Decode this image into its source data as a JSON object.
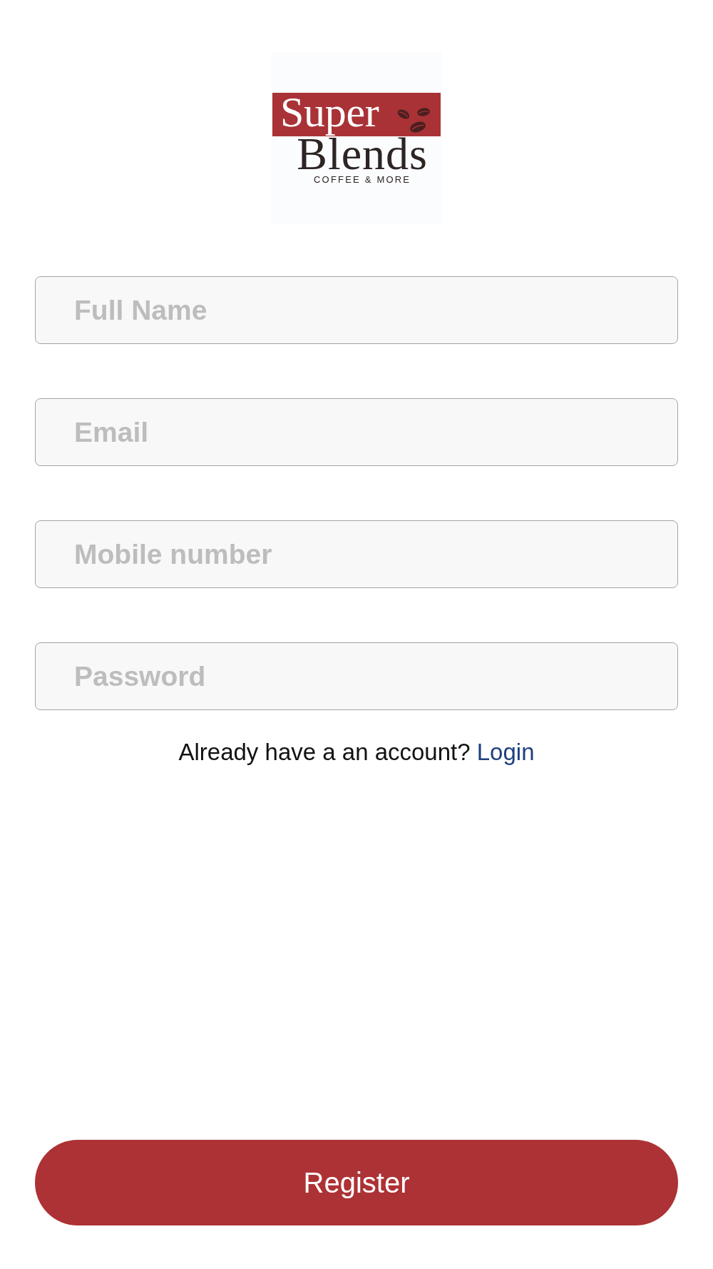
{
  "logo": {
    "title_top": "Super",
    "title_bottom": "Blends",
    "tagline": "COFFEE & MORE"
  },
  "fields": [
    {
      "placeholder": "Full Name"
    },
    {
      "placeholder": "Email"
    },
    {
      "placeholder": "Mobile number"
    },
    {
      "placeholder": "Password"
    }
  ],
  "login_prompt": {
    "text": "Already have a an account?",
    "link": "Login"
  },
  "register_button": {
    "label": "Register"
  }
}
